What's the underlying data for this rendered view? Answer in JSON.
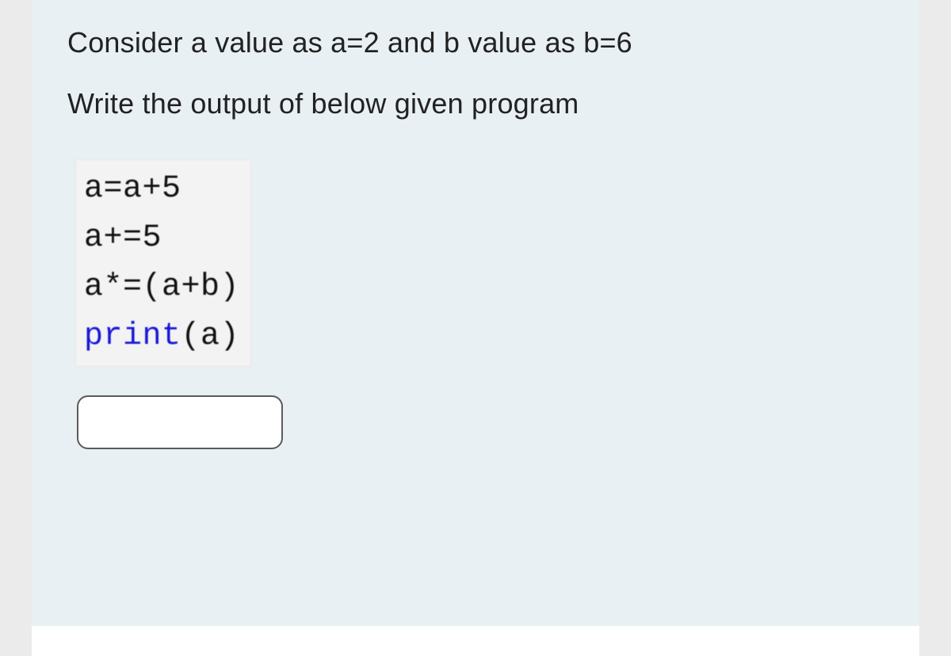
{
  "question": {
    "line1": "Consider a value as a=2 and b value as b=6",
    "line2": "Write the output of below given program"
  },
  "code": {
    "l1": "a=a+5",
    "l2": "a+=5",
    "l3_pre": "a*=(a+b)",
    "l4_fn": "print",
    "l4_arg": "(a)"
  },
  "answer": {
    "value": "",
    "placeholder": ""
  }
}
